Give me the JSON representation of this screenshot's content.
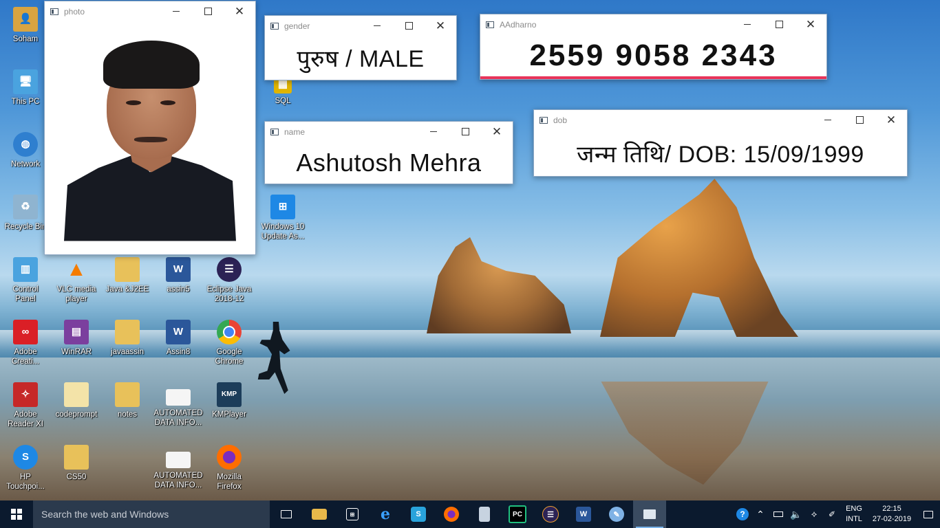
{
  "desktop": {
    "icons": [
      {
        "label": "Soham",
        "color": "#d9a441"
      },
      {
        "label": "This PC",
        "color": "#4aa3df"
      },
      {
        "label": "Network",
        "color": "#2f7fcf"
      },
      {
        "label": "Recycle Bin",
        "color": "#8fb4d0"
      },
      {
        "label": "SQL",
        "color": "#e0b400"
      },
      {
        "label": "Windows 10\nUpdate As...",
        "color": "#1e88e5"
      },
      {
        "label": "Control\nPanel",
        "color": "#4aa3df"
      },
      {
        "label": "VLC media\nplayer",
        "color": "#f57c00"
      },
      {
        "label": "Java &J2EE",
        "color": "#e8c15a"
      },
      {
        "label": "assin5",
        "color": "#2b579a"
      },
      {
        "label": "Eclipse Java\n2018-12",
        "color": "#2c2255"
      },
      {
        "label": "Adobe\nCreati...",
        "color": "#da1f26"
      },
      {
        "label": "WinRAR",
        "color": "#7b3f9e"
      },
      {
        "label": "javaassin",
        "color": "#e8c15a"
      },
      {
        "label": "Assin8",
        "color": "#2b579a"
      },
      {
        "label": "Google\nChrome",
        "color": "#34a853"
      },
      {
        "label": "Adobe\nReader XI",
        "color": "#c62828"
      },
      {
        "label": "codeprompt",
        "color": "#f3e3a8"
      },
      {
        "label": "notes",
        "color": "#e8c15a"
      },
      {
        "label": "AUTOMATED\nDATA INFO...",
        "color": "#f5f5f5"
      },
      {
        "label": "KMPlayer",
        "color": "#1c3d5a"
      },
      {
        "label": "HP\nTouchpoi...",
        "color": "#1e88e5"
      },
      {
        "label": "CS50",
        "color": "#e8c15a"
      },
      {
        "label": "AUTOMATED\nDATA INFO...",
        "color": "#f5f5f5"
      },
      {
        "label": "Mozilla\nFirefox",
        "color": "#ff6d00"
      }
    ]
  },
  "windows": {
    "photo": {
      "title": "photo"
    },
    "gender": {
      "title": "gender",
      "text": "पुरुष  / MALE"
    },
    "aadhar": {
      "title": "AAdharno",
      "text": "2559 9058 2343"
    },
    "name": {
      "title": "name",
      "text": "Ashutosh Mehra"
    },
    "dob": {
      "title": "dob",
      "text": "जन्म तिथि/ DOB: 15/09/1999"
    }
  },
  "taskbar": {
    "search_placeholder": "Search the web and Windows",
    "pinned": [
      {
        "name": "task-view-icon",
        "glyph": "❐",
        "color": "transparent"
      },
      {
        "name": "file-explorer-icon",
        "glyph": "",
        "color": "#e8b84a"
      },
      {
        "name": "store-icon",
        "glyph": "🛍",
        "color": "transparent"
      },
      {
        "name": "edge-icon",
        "glyph": "e",
        "color": "#1e88e5"
      },
      {
        "name": "hp-icon",
        "glyph": "S",
        "color": "#29a3db"
      },
      {
        "name": "firefox-icon",
        "glyph": "●",
        "color": "#ff6d00"
      },
      {
        "name": "document-icon",
        "glyph": "▤",
        "color": "#c7d3e0"
      },
      {
        "name": "pycharm-icon",
        "glyph": "PC",
        "color": "#20c080"
      },
      {
        "name": "eclipse-icon",
        "glyph": "◐",
        "color": "#2c2255"
      },
      {
        "name": "word-icon",
        "glyph": "W",
        "color": "#2b579a"
      },
      {
        "name": "paint-icon",
        "glyph": "✎",
        "color": "#7fb2e5"
      },
      {
        "name": "active-window-icon",
        "glyph": "▣",
        "color": "#dfe7ef"
      }
    ],
    "language": {
      "top": "ENG",
      "bottom": "INTL"
    },
    "time": "22:15",
    "date": "27-02-2019"
  }
}
